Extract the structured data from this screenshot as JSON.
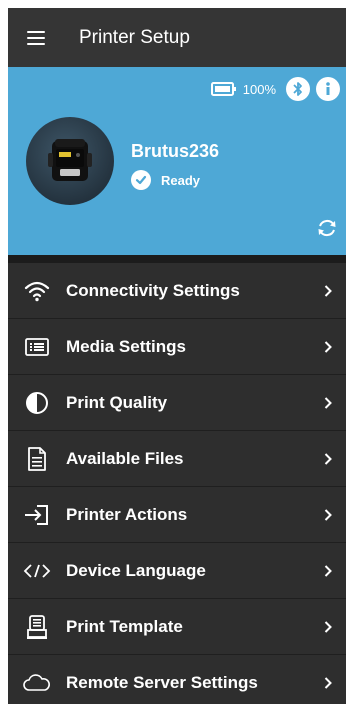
{
  "app": {
    "title": "Printer Setup"
  },
  "status": {
    "battery": "100%"
  },
  "printer": {
    "name": "Brutus236",
    "status": "Ready"
  },
  "colors": {
    "header_bg": "#4ea8d6",
    "appbar_bg": "#353535",
    "list_bg": "#2e2e2e"
  },
  "menu": [
    {
      "label": "Connectivity Settings",
      "icon": "wifi-icon"
    },
    {
      "label": "Media Settings",
      "icon": "list-box-icon"
    },
    {
      "label": "Print Quality",
      "icon": "contrast-icon"
    },
    {
      "label": "Available Files",
      "icon": "document-icon"
    },
    {
      "label": "Printer Actions",
      "icon": "login-arrow-icon"
    },
    {
      "label": "Device Language",
      "icon": "code-icon"
    },
    {
      "label": "Print Template",
      "icon": "printer-template-icon"
    },
    {
      "label": "Remote Server Settings",
      "icon": "cloud-icon"
    }
  ]
}
